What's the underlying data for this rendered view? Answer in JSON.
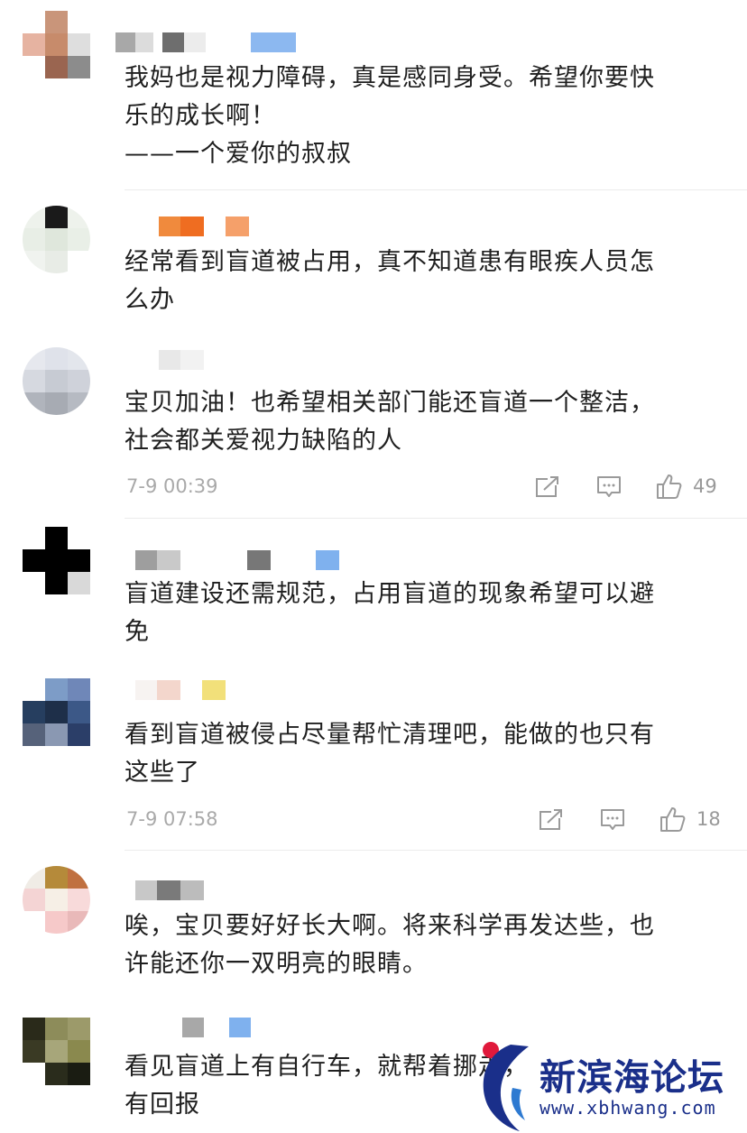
{
  "comments": [
    {
      "text": "我妈也是视力障碍，真是感同身受。希望你要快\n乐的成长啊！\n——一个爱你的叔叔"
    },
    {
      "text": "经常看到盲道被占用，真不知道患有眼疾人员怎\n么办"
    },
    {
      "text": "宝贝加油！也希望相关部门能还盲道一个整洁，\n社会都关爱视力缺陷的人",
      "time": "7-9 00:39",
      "likes": "49"
    },
    {
      "text": "盲道建设还需规范，占用盲道的现象希望可以避\n免"
    },
    {
      "text": "看到盲道被侵占尽量帮忙清理吧，能做的也只有\n这些了",
      "time": "7-9 07:58",
      "likes": "18"
    },
    {
      "text": "唉，宝贝要好好长大啊。将来科学再发达些，也\n许能还你一双明亮的眼睛。"
    },
    {
      "text": "看见盲道上有自行车，就帮着挪走，\n有回报"
    }
  ],
  "icons": {
    "share": "share-icon",
    "comment": "comment-icon",
    "like": "thumbs-up-icon"
  },
  "watermark": {
    "title": "新滨海论坛",
    "url": "www.xbhwang.com"
  },
  "colors": {
    "text": "#1f1f1f",
    "meta": "#a9a9a9",
    "divider": "#ececec",
    "brand": "#1a2f8a",
    "brand_dot": "#e0193b"
  }
}
